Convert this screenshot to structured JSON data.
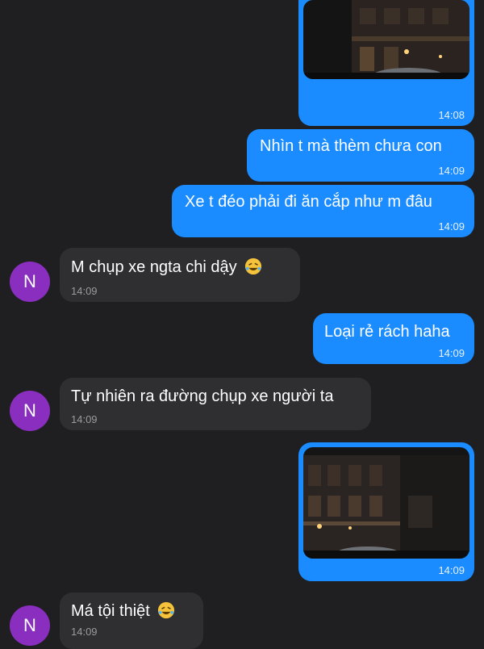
{
  "messages": [
    {
      "id": "m1",
      "type": "image",
      "side": "out",
      "time": "14:08"
    },
    {
      "id": "m2",
      "type": "text",
      "side": "out",
      "text": "Nhìn t mà thèm chưa con",
      "time": "14:09"
    },
    {
      "id": "m3",
      "type": "text",
      "side": "out",
      "text": "Xe t đéo phải đi ăn cắp như m đâu",
      "time": "14:09"
    },
    {
      "id": "m4",
      "type": "text",
      "side": "in",
      "avatar": "N",
      "text": "M chụp xe ngta chi dậy",
      "emoji": "rofl-emoji",
      "time": "14:09"
    },
    {
      "id": "m5",
      "type": "text",
      "side": "out",
      "text": "Loại rẻ rách haha",
      "time": "14:09"
    },
    {
      "id": "m6",
      "type": "text",
      "side": "in",
      "avatar": "N",
      "text": "Tự nhiên ra đường chụp xe người ta",
      "time": "14:09"
    },
    {
      "id": "m7",
      "type": "image",
      "side": "out",
      "time": "14:09"
    },
    {
      "id": "m8",
      "type": "text",
      "side": "in",
      "avatar": "N",
      "text": "Má tội thiệt",
      "emoji": "rofl-emoji",
      "time": "14:09"
    }
  ],
  "colors": {
    "background": "#1f1f21",
    "outgoing_bubble": "#1a8cff",
    "incoming_bubble": "#2f2f31",
    "avatar": "#8a2ec0"
  }
}
